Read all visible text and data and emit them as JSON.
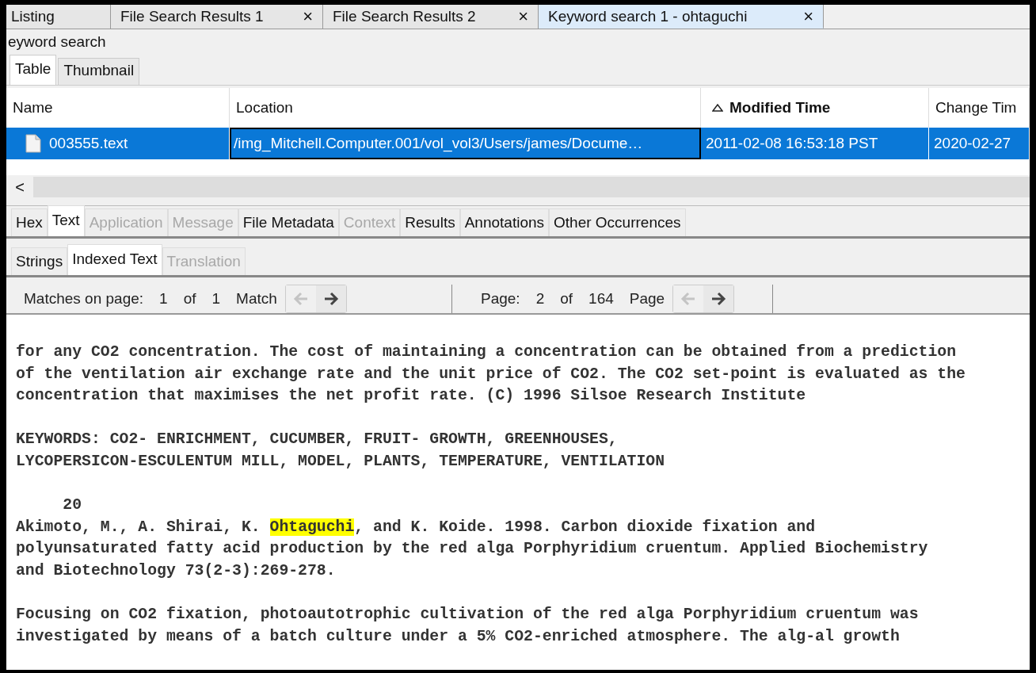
{
  "top_tabs": [
    {
      "label": "Listing",
      "closable": false,
      "selected": false
    },
    {
      "label": "File Search Results 1",
      "closable": true,
      "selected": false
    },
    {
      "label": "File Search Results 2",
      "closable": true,
      "selected": false
    },
    {
      "label": "Keyword search 1 - ohtaguchi",
      "closable": true,
      "selected": true
    }
  ],
  "close_glyph": "×",
  "panel_title": "eyword search",
  "view_tabs": [
    {
      "label": "Table",
      "selected": true
    },
    {
      "label": "Thumbnail",
      "selected": false
    }
  ],
  "table": {
    "columns": [
      {
        "label": "Name",
        "sorted": false
      },
      {
        "label": "Location",
        "sorted": false
      },
      {
        "label": "Modified Time",
        "sorted": true
      },
      {
        "label": "Change Tim",
        "sorted": false
      }
    ],
    "rows": [
      {
        "selected": true,
        "cells": [
          "003555.text",
          "/img_Mitchell.Computer.001/vol_vol3/Users/james/Docume…",
          "2011-02-08 16:53:18 PST",
          "2020-02-27"
        ]
      }
    ]
  },
  "scroll_left_glyph": "<",
  "viewer_tabs": [
    {
      "label": "Hex",
      "selected": false,
      "disabled": false
    },
    {
      "label": "Text",
      "selected": true,
      "disabled": false
    },
    {
      "label": "Application",
      "selected": false,
      "disabled": true
    },
    {
      "label": "Message",
      "selected": false,
      "disabled": true
    },
    {
      "label": "File Metadata",
      "selected": false,
      "disabled": false
    },
    {
      "label": "Context",
      "selected": false,
      "disabled": true
    },
    {
      "label": "Results",
      "selected": false,
      "disabled": false
    },
    {
      "label": "Annotations",
      "selected": false,
      "disabled": false
    },
    {
      "label": "Other Occurrences",
      "selected": false,
      "disabled": false
    }
  ],
  "sub_tabs": [
    {
      "label": "Strings",
      "selected": false,
      "disabled": false
    },
    {
      "label": "Indexed Text",
      "selected": true,
      "disabled": false
    },
    {
      "label": "Translation",
      "selected": false,
      "disabled": true
    }
  ],
  "toolbar": {
    "matches": {
      "label": "Matches on page:",
      "current": "1",
      "of": "of",
      "total": "1",
      "unit": "Match",
      "prev_disabled": true,
      "next_disabled": false
    },
    "pages": {
      "label": "Page:",
      "current": "2",
      "of": "of",
      "total": "164",
      "unit": "Page",
      "prev_disabled": true,
      "next_disabled": false
    }
  },
  "paragraphs": [
    [
      [
        {
          "text": "for any CO2 concentration. The cost of maintaining a concentration can be obtained from a prediction",
          "highlighted": false
        }
      ],
      [
        {
          "text": "of the ventilation air exchange rate and the unit price of CO2. The CO2 set-point is evaluated as the",
          "highlighted": false
        }
      ],
      [
        {
          "text": "concentration that maximises the net profit rate. (C) 1996 Silsoe Research Institute",
          "highlighted": false
        }
      ]
    ],
    [
      [
        {
          "text": "KEYWORDS: CO2- ENRICHMENT, CUCUMBER, FRUIT- GROWTH, GREENHOUSES,",
          "highlighted": false
        }
      ],
      [
        {
          "text": "LYCOPERSICON-ESCULENTUM MILL, MODEL, PLANTS, TEMPERATURE, VENTILATION",
          "highlighted": false
        }
      ]
    ],
    [
      [
        {
          "text": "     20",
          "highlighted": false
        }
      ],
      [
        {
          "text": "Akimoto, M., A. Shirai, K. ",
          "highlighted": false
        },
        {
          "text": "Ohtaguchi",
          "highlighted": true
        },
        {
          "text": ", and K. Koide. 1998. Carbon dioxide fixation and",
          "highlighted": false
        }
      ],
      [
        {
          "text": "polyunsaturated fatty acid production by the red alga Porphyridium cruentum. Applied Biochemistry",
          "highlighted": false
        }
      ],
      [
        {
          "text": "and Biotechnology 73(2-3):269-278.",
          "highlighted": false
        }
      ]
    ],
    [
      [
        {
          "text": "Focusing on CO2 fixation, photoautotrophic cultivation of the red alga Porphyridium cruentum was",
          "highlighted": false
        }
      ],
      [
        {
          "text": "investigated by means of a batch culture under a 5% CO2-enriched atmosphere. The alg-al growth",
          "highlighted": false
        }
      ]
    ]
  ]
}
